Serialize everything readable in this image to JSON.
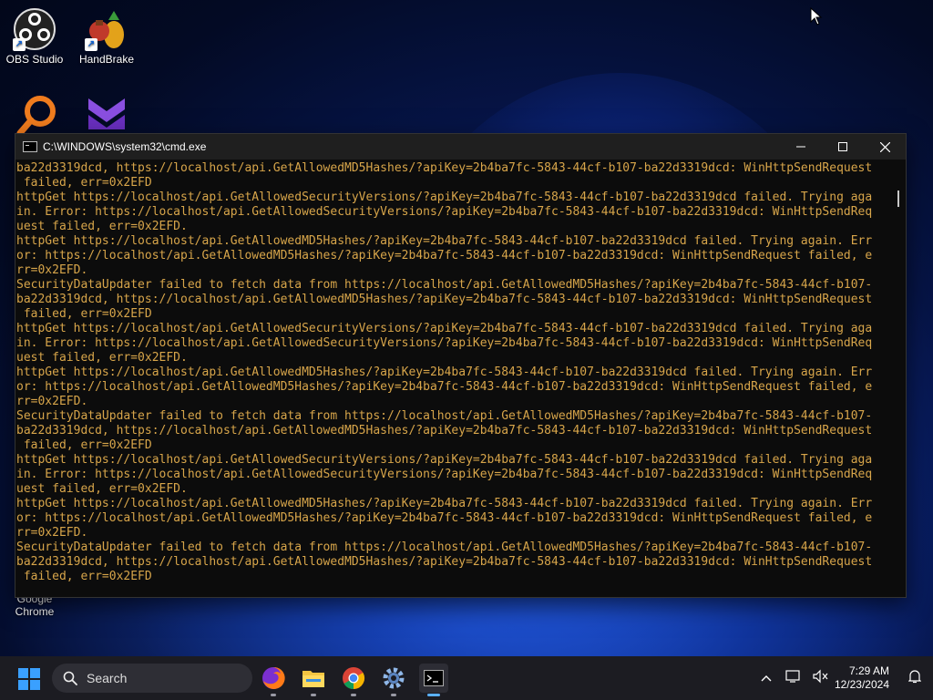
{
  "desktop": {
    "icons": [
      {
        "label": "OBS Studio"
      },
      {
        "label": "HandBrake"
      },
      {
        "label": "Google Chrome"
      }
    ]
  },
  "window": {
    "title": "C:\\WINDOWS\\system32\\cmd.exe",
    "lines": [
      "ba22d3319dcd, https://localhost/api.GetAllowedMD5Hashes/?apiKey=2b4ba7fc-5843-44cf-b107-ba22d3319dcd: WinHttpSendRequest",
      " failed, err=0x2EFD",
      "httpGet https://localhost/api.GetAllowedSecurityVersions/?apiKey=2b4ba7fc-5843-44cf-b107-ba22d3319dcd failed. Trying aga",
      "in. Error: https://localhost/api.GetAllowedSecurityVersions/?apiKey=2b4ba7fc-5843-44cf-b107-ba22d3319dcd: WinHttpSendReq",
      "uest failed, err=0x2EFD.",
      "httpGet https://localhost/api.GetAllowedMD5Hashes/?apiKey=2b4ba7fc-5843-44cf-b107-ba22d3319dcd failed. Trying again. Err",
      "or: https://localhost/api.GetAllowedMD5Hashes/?apiKey=2b4ba7fc-5843-44cf-b107-ba22d3319dcd: WinHttpSendRequest failed, e",
      "rr=0x2EFD.",
      "SecurityDataUpdater failed to fetch data from https://localhost/api.GetAllowedMD5Hashes/?apiKey=2b4ba7fc-5843-44cf-b107-",
      "ba22d3319dcd, https://localhost/api.GetAllowedMD5Hashes/?apiKey=2b4ba7fc-5843-44cf-b107-ba22d3319dcd: WinHttpSendRequest",
      " failed, err=0x2EFD",
      "httpGet https://localhost/api.GetAllowedSecurityVersions/?apiKey=2b4ba7fc-5843-44cf-b107-ba22d3319dcd failed. Trying aga",
      "in. Error: https://localhost/api.GetAllowedSecurityVersions/?apiKey=2b4ba7fc-5843-44cf-b107-ba22d3319dcd: WinHttpSendReq",
      "uest failed, err=0x2EFD.",
      "httpGet https://localhost/api.GetAllowedMD5Hashes/?apiKey=2b4ba7fc-5843-44cf-b107-ba22d3319dcd failed. Trying again. Err",
      "or: https://localhost/api.GetAllowedMD5Hashes/?apiKey=2b4ba7fc-5843-44cf-b107-ba22d3319dcd: WinHttpSendRequest failed, e",
      "rr=0x2EFD.",
      "SecurityDataUpdater failed to fetch data from https://localhost/api.GetAllowedMD5Hashes/?apiKey=2b4ba7fc-5843-44cf-b107-",
      "ba22d3319dcd, https://localhost/api.GetAllowedMD5Hashes/?apiKey=2b4ba7fc-5843-44cf-b107-ba22d3319dcd: WinHttpSendRequest",
      " failed, err=0x2EFD",
      "httpGet https://localhost/api.GetAllowedSecurityVersions/?apiKey=2b4ba7fc-5843-44cf-b107-ba22d3319dcd failed. Trying aga",
      "in. Error: https://localhost/api.GetAllowedSecurityVersions/?apiKey=2b4ba7fc-5843-44cf-b107-ba22d3319dcd: WinHttpSendReq",
      "uest failed, err=0x2EFD.",
      "httpGet https://localhost/api.GetAllowedMD5Hashes/?apiKey=2b4ba7fc-5843-44cf-b107-ba22d3319dcd failed. Trying again. Err",
      "or: https://localhost/api.GetAllowedMD5Hashes/?apiKey=2b4ba7fc-5843-44cf-b107-ba22d3319dcd: WinHttpSendRequest failed, e",
      "rr=0x2EFD.",
      "SecurityDataUpdater failed to fetch data from https://localhost/api.GetAllowedMD5Hashes/?apiKey=2b4ba7fc-5843-44cf-b107-",
      "ba22d3319dcd, https://localhost/api.GetAllowedMD5Hashes/?apiKey=2b4ba7fc-5843-44cf-b107-ba22d3319dcd: WinHttpSendRequest",
      " failed, err=0x2EFD"
    ]
  },
  "taskbar": {
    "search_label": "Search",
    "time": "7:29 AM",
    "date": "12/23/2024"
  },
  "colors": {
    "console_text": "#d7a54a",
    "console_bg": "#0c0c0c"
  }
}
